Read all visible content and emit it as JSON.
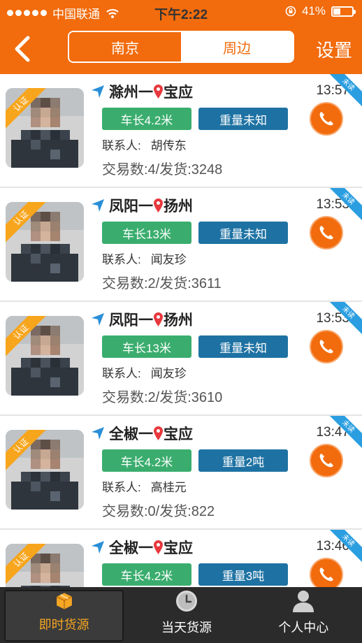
{
  "status_bar": {
    "carrier": "中国联通",
    "time": "下午2:22",
    "battery": "41%",
    "battery_level": 0.41
  },
  "nav": {
    "tabs": [
      {
        "label": "南京",
        "active": true
      },
      {
        "label": "周边",
        "active": false
      }
    ],
    "settings_label": "设置"
  },
  "listings": [
    {
      "from": "滁州",
      "dash": "一",
      "to": "宝应",
      "time": "13:57",
      "length": "车长4.2米",
      "weight": "重量未知",
      "contact_label": "联系人:",
      "contact_name": "胡传东",
      "stats": "交易数:4/发货:3248",
      "badge": "认证",
      "unread": "未读"
    },
    {
      "from": "凤阳",
      "dash": "一",
      "to": "扬州",
      "time": "13:53",
      "length": "车长13米",
      "weight": "重量未知",
      "contact_label": "联系人:",
      "contact_name": "闻友珍",
      "stats": "交易数:2/发货:3611",
      "badge": "认证",
      "unread": "未读"
    },
    {
      "from": "凤阳",
      "dash": "一",
      "to": "扬州",
      "time": "13:53",
      "length": "车长13米",
      "weight": "重量未知",
      "contact_label": "联系人:",
      "contact_name": "闻友珍",
      "stats": "交易数:2/发货:3610",
      "badge": "认证",
      "unread": "未读"
    },
    {
      "from": "全椒",
      "dash": "一",
      "to": "宝应",
      "time": "13:47",
      "length": "车长4.2米",
      "weight": "重量2吨",
      "contact_label": "联系人:",
      "contact_name": "高桂元",
      "stats": "交易数:0/发货:822",
      "badge": "认证",
      "unread": "未读"
    },
    {
      "from": "全椒",
      "dash": "一",
      "to": "宝应",
      "time": "13:46",
      "length": "车长4.2米",
      "weight": "重量3吨",
      "contact_label": "",
      "contact_name": "",
      "stats": "",
      "badge": "认证",
      "unread": "未读"
    }
  ],
  "tabbar": [
    {
      "label": "即时货源",
      "icon": "box-icon",
      "active": true
    },
    {
      "label": "当天货源",
      "icon": "clock-icon",
      "active": false
    },
    {
      "label": "个人中心",
      "icon": "user-icon",
      "active": false
    }
  ],
  "colors": {
    "accent": "#f26b0c",
    "green_tag": "#3aad6e",
    "blue_tag": "#1e72a3",
    "tab_active": "#f5a623"
  }
}
